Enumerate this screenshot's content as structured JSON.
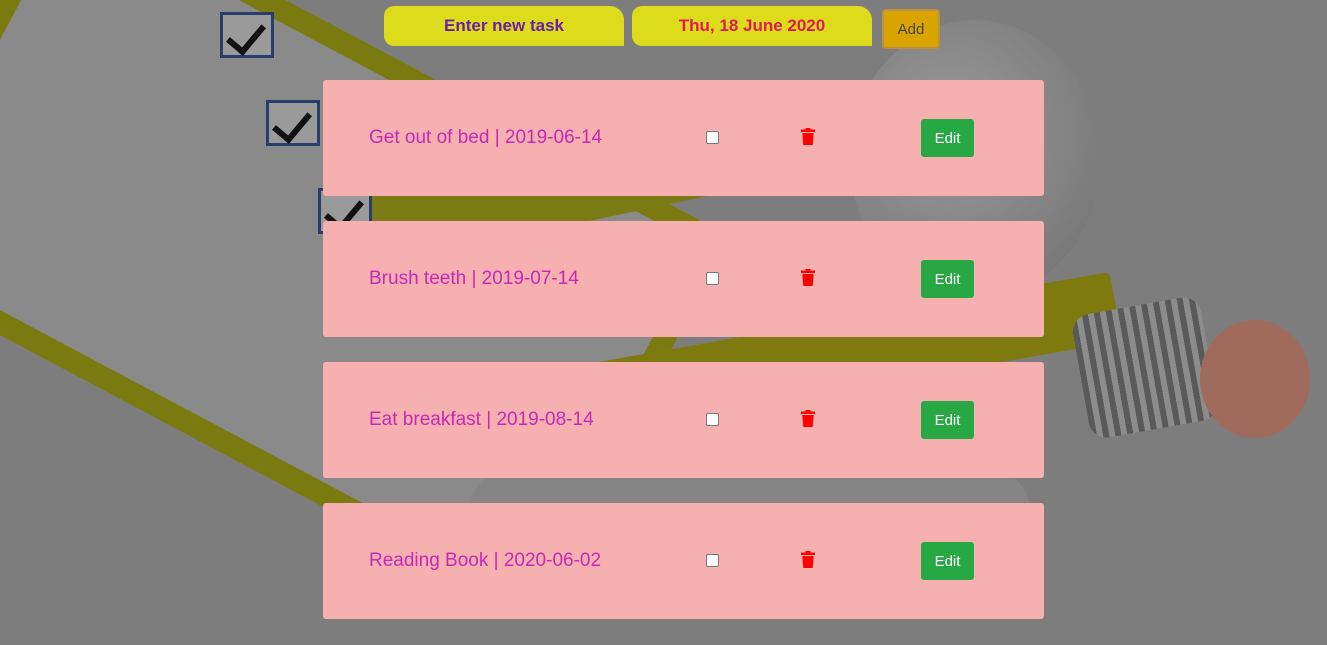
{
  "form": {
    "task_placeholder": "Enter new task",
    "date_value": "Thu, 18 June 2020",
    "add_label": "Add"
  },
  "tasks": [
    {
      "text": "Get out of bed | 2019-06-14",
      "checked": false,
      "edit_label": "Edit"
    },
    {
      "text": "Brush teeth | 2019-07-14",
      "checked": false,
      "edit_label": "Edit"
    },
    {
      "text": "Eat breakfast | 2019-08-14",
      "checked": false,
      "edit_label": "Edit"
    },
    {
      "text": "Reading Book | 2020-06-02",
      "checked": false,
      "edit_label": "Edit"
    }
  ],
  "icons": {
    "delete": "trash-icon"
  },
  "colors": {
    "input_bg": "#dddc1c",
    "task_bg": "#f7b0b0",
    "task_text": "#c828b8",
    "edit_bg": "#28a745",
    "add_bg": "#d9a400",
    "trash": "#ff0000"
  }
}
